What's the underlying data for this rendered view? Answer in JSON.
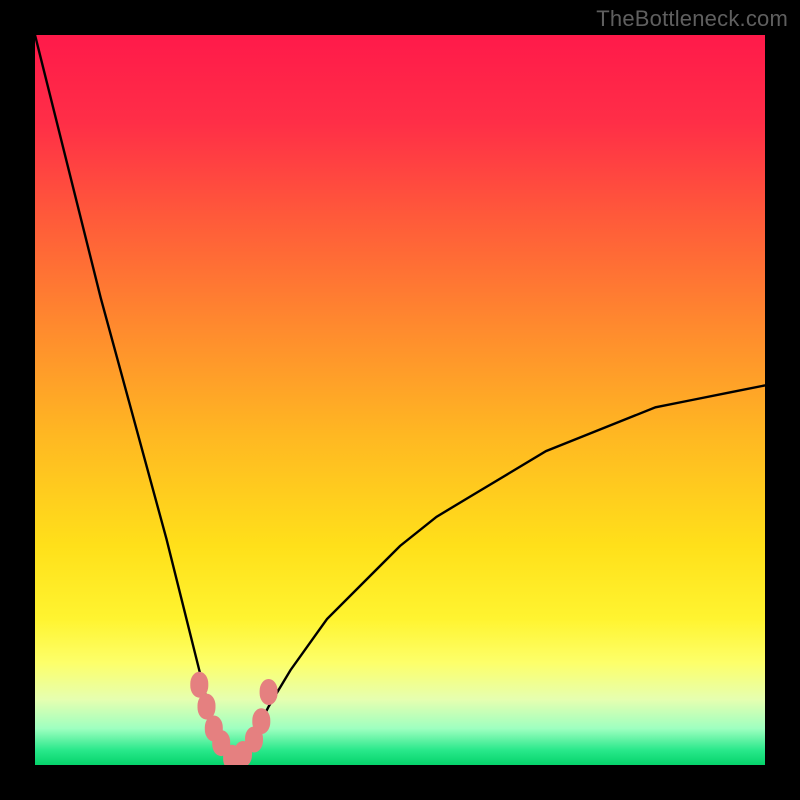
{
  "watermark": "TheBottleneck.com",
  "gradient_stops": [
    {
      "offset": 0.0,
      "color": "#ff1a4a"
    },
    {
      "offset": 0.12,
      "color": "#ff2e47"
    },
    {
      "offset": 0.25,
      "color": "#ff5a3a"
    },
    {
      "offset": 0.4,
      "color": "#ff8a2e"
    },
    {
      "offset": 0.55,
      "color": "#ffb822"
    },
    {
      "offset": 0.7,
      "color": "#ffe01a"
    },
    {
      "offset": 0.8,
      "color": "#fff430"
    },
    {
      "offset": 0.86,
      "color": "#fdff6a"
    },
    {
      "offset": 0.91,
      "color": "#e6ffb0"
    },
    {
      "offset": 0.95,
      "color": "#9effc0"
    },
    {
      "offset": 0.98,
      "color": "#28e88a"
    },
    {
      "offset": 1.0,
      "color": "#05d36b"
    }
  ],
  "salmon_color": "#e58080",
  "chart_data": {
    "type": "line",
    "title": "",
    "xlabel": "",
    "ylabel": "",
    "xlim": [
      0,
      100
    ],
    "ylim": [
      0,
      100
    ],
    "description": "Bottleneck percentage curve vs performance ratio; minimum ~0% at x≈27, rising toward 100% as x→0 and toward ~50% as x→100.",
    "series": [
      {
        "name": "bottleneck-curve",
        "x": [
          0,
          3,
          6,
          9,
          12,
          15,
          18,
          20,
          22,
          24,
          25,
          26,
          27,
          28,
          29,
          30,
          32,
          35,
          40,
          45,
          50,
          55,
          60,
          65,
          70,
          75,
          80,
          85,
          90,
          95,
          100
        ],
        "values": [
          100,
          88,
          76,
          64,
          53,
          42,
          31,
          23,
          15,
          7,
          4,
          2,
          1,
          1,
          2,
          4,
          8,
          13,
          20,
          25,
          30,
          34,
          37,
          40,
          43,
          45,
          47,
          49,
          50,
          51,
          52
        ]
      }
    ],
    "markers": {
      "name": "highlighted-range",
      "color": "#e58080",
      "x": [
        22.5,
        23.5,
        24.5,
        25.5,
        27.0,
        28.5,
        30.0,
        31.0,
        32.0
      ],
      "values": [
        11.0,
        8.0,
        5.0,
        3.0,
        1.0,
        1.5,
        3.5,
        6.0,
        10.0
      ]
    }
  }
}
